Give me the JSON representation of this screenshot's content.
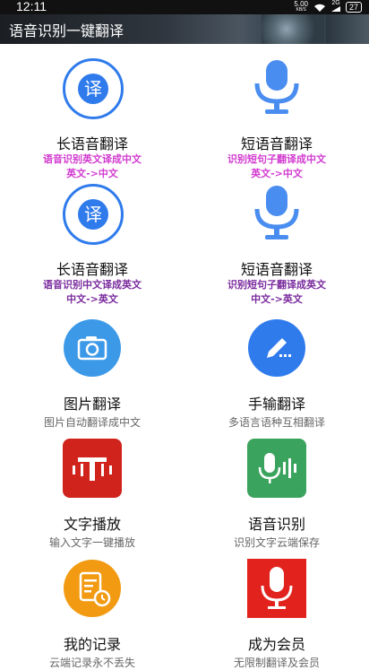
{
  "status": {
    "time": "12:11",
    "speed_value": "5.00",
    "speed_unit": "KB/S",
    "network": "2G",
    "battery": "27"
  },
  "app": {
    "title": "语音识别一键翻译"
  },
  "items": [
    {
      "title": "长语音翻译",
      "line1": "语音识别英文译成中文",
      "line2": "英文->中文",
      "icon": "translate-circle-icon"
    },
    {
      "title": "短语音翻译",
      "line1": "识别短句子翻译成中文",
      "line2": "英文->中文",
      "icon": "microphone-icon"
    },
    {
      "title": "长语音翻译",
      "line1": "语音识别中文译成英文",
      "line2": "中文->英文",
      "icon": "translate-circle-icon"
    },
    {
      "title": "短语音翻译",
      "line1": "识别短句子翻译成英文",
      "line2": "中文->英文",
      "icon": "microphone-icon"
    },
    {
      "title": "图片翻译",
      "line1": "图片自动翻译成中文",
      "icon": "camera-icon"
    },
    {
      "title": "手输翻译",
      "line1": "多语言语种互相翻译",
      "icon": "pencil-icon"
    },
    {
      "title": "文字播放",
      "line1": "输入文字一键播放",
      "icon": "text-to-speech-icon"
    },
    {
      "title": "语音识别",
      "line1": "识别文字云端保存",
      "icon": "voice-wave-mic-icon"
    },
    {
      "title": "我的记录",
      "line1": "云端记录永不丢失",
      "icon": "record-clock-icon"
    },
    {
      "title": "成为会员",
      "line1": "无限制翻译及会员",
      "icon": "red-microphone-icon"
    }
  ],
  "translate_glyph": "译",
  "colors": {
    "blue": "#2f7bec",
    "pink": "#d23bd0",
    "purple": "#7a2b9e",
    "red": "#d0231c",
    "green": "#3aa35d",
    "orange": "#f29a12"
  }
}
